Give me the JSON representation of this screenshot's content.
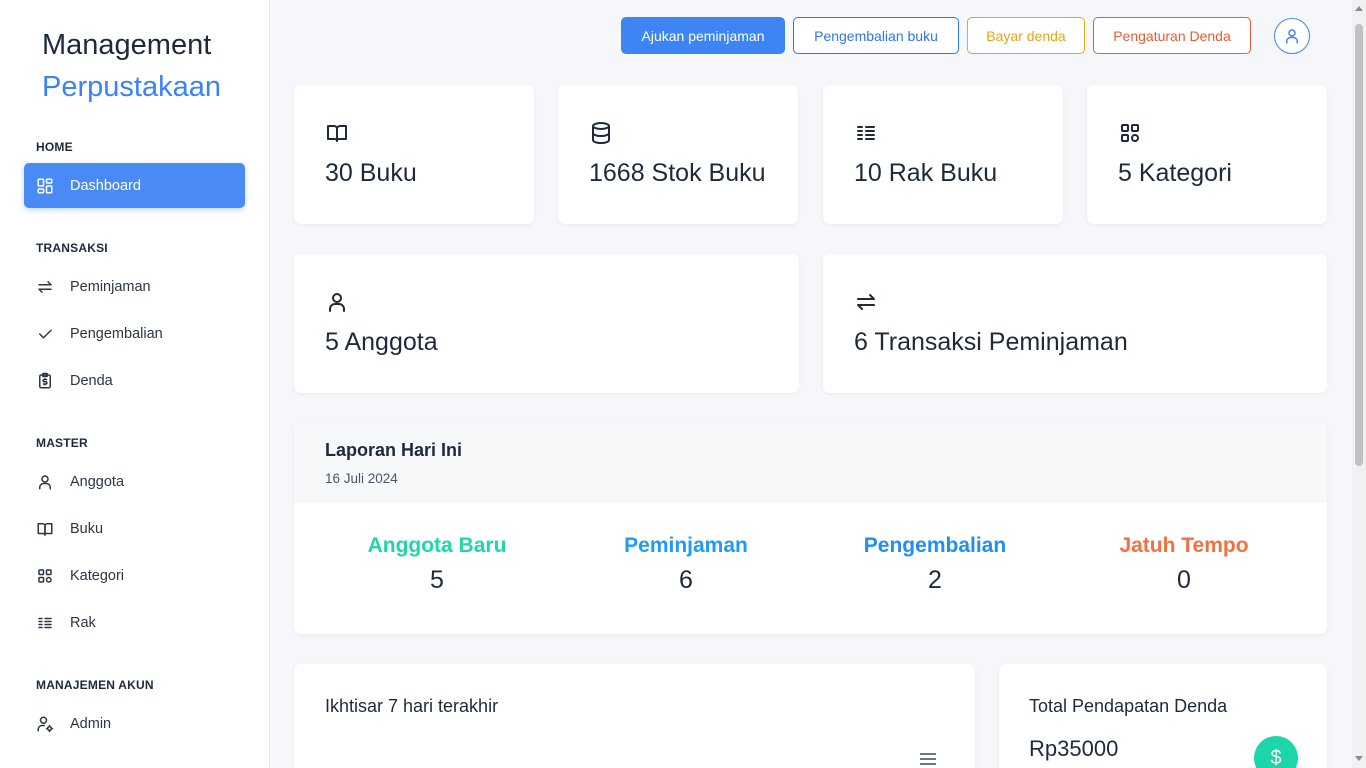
{
  "brand": {
    "line1": "Management",
    "line2": "Perpustakaan"
  },
  "sidebar": {
    "sections": [
      {
        "title": "HOME",
        "items": [
          {
            "label": "Dashboard",
            "icon": "dashboard-icon",
            "active": true
          }
        ]
      },
      {
        "title": "TRANSAKSI",
        "items": [
          {
            "label": "Peminjaman",
            "icon": "swap-arrows-icon"
          },
          {
            "label": "Pengembalian",
            "icon": "check-icon"
          },
          {
            "label": "Denda",
            "icon": "clipboard-dollar-icon"
          }
        ]
      },
      {
        "title": "MASTER",
        "items": [
          {
            "label": "Anggota",
            "icon": "user-icon"
          },
          {
            "label": "Buku",
            "icon": "open-book-icon"
          },
          {
            "label": "Kategori",
            "icon": "category-grid-icon"
          },
          {
            "label": "Rak",
            "icon": "list-icon"
          }
        ]
      },
      {
        "title": "MANAJEMEN AKUN",
        "items": [
          {
            "label": "Admin",
            "icon": "user-gear-icon"
          }
        ]
      }
    ]
  },
  "topbar": {
    "buttons": [
      {
        "label": "Ajukan peminjaman"
      },
      {
        "label": "Pengembalian buku"
      },
      {
        "label": "Bayar denda"
      },
      {
        "label": "Pengaturan Denda"
      }
    ],
    "avatar_icon": "user-icon"
  },
  "stats": [
    {
      "value": "30 Buku",
      "icon": "open-book-icon"
    },
    {
      "value": "1668 Stok Buku",
      "icon": "database-icon"
    },
    {
      "value": "10 Rak Buku",
      "icon": "list-icon"
    },
    {
      "value": "5 Kategori",
      "icon": "category-grid-icon"
    },
    {
      "value": "5 Anggota",
      "icon": "user-icon"
    },
    {
      "value": "6 Transaksi Peminjaman",
      "icon": "swap-arrows-icon"
    }
  ],
  "report": {
    "title": "Laporan Hari Ini",
    "date": "16 Juli 2024",
    "metrics": [
      {
        "label": "Anggota Baru",
        "value": "5",
        "color": "#1fd6a7"
      },
      {
        "label": "Peminjaman",
        "value": "6",
        "color": "#1f9cf0"
      },
      {
        "label": "Pengembalian",
        "value": "2",
        "color": "#1f8ff0"
      },
      {
        "label": "Jatuh Tempo",
        "value": "0",
        "color": "#f2703f"
      }
    ]
  },
  "overview": {
    "title": "Ikhtisar 7 hari terakhir",
    "menu_icon": "hamburger-menu-icon"
  },
  "fines": {
    "title": "Total Pendapatan Denda",
    "value": "Rp35000",
    "icon": "dollar-icon"
  },
  "colors": {
    "primary": "#3d84f4",
    "warning": "#e9a417",
    "danger": "#ec5b33",
    "success": "#1cd5a8"
  }
}
